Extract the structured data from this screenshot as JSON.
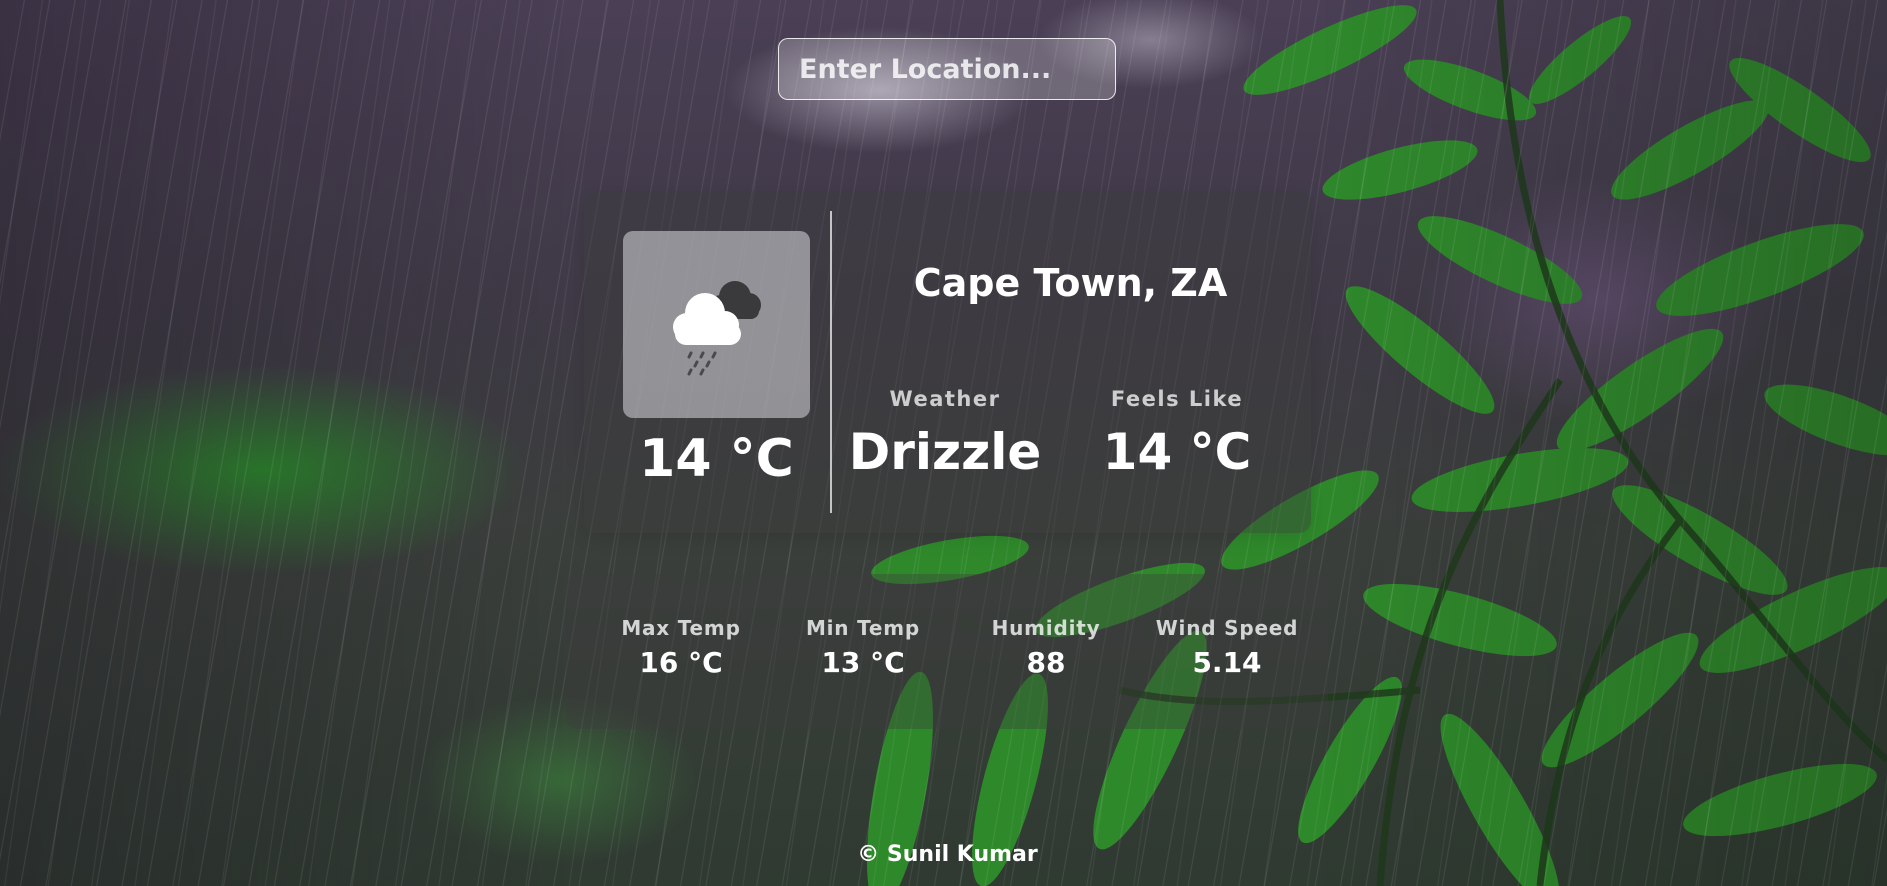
{
  "search": {
    "placeholder": "Enter Location...",
    "value": ""
  },
  "weather": {
    "icon": "cloud-drizzle-icon",
    "temperature": "14 °C",
    "location": "Cape Town, ZA",
    "condition_label": "Weather",
    "condition": "Drizzle",
    "feels_like_label": "Feels Like",
    "feels_like": "14 °C"
  },
  "details": [
    {
      "label": "Max Temp",
      "value": "16 °C"
    },
    {
      "label": "Min Temp",
      "value": "13 °C"
    },
    {
      "label": "Humidity",
      "value": "88"
    },
    {
      "label": "Wind Speed",
      "value": "5.14"
    }
  ],
  "footer": {
    "credit": "© Sunil Kumar"
  },
  "colors": {
    "text": "#ffffff",
    "card": "#3c3c3c",
    "leaf": "#2e8f2a"
  }
}
